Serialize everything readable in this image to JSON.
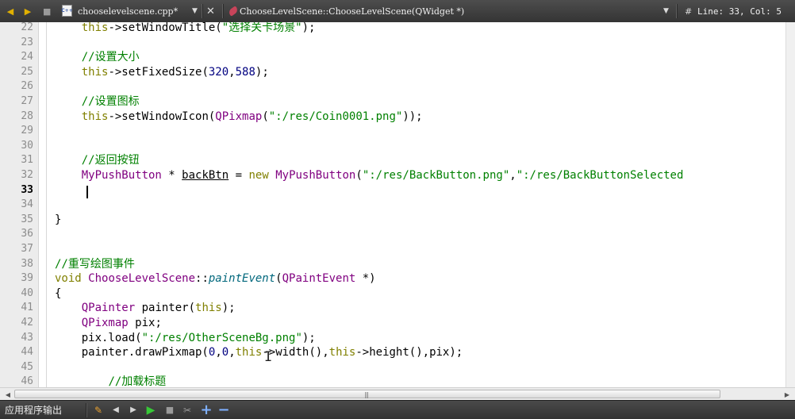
{
  "toolbar": {
    "back_icon": "back-arrow-icon",
    "forward_icon": "forward-arrow-icon",
    "file_badge": "C++",
    "file_name": "chooselevelscene.cpp*",
    "dropdown_arrow": "▼",
    "close_symbol": "✕",
    "function_name": "ChooseLevelScene::ChooseLevelScene(QWidget *)",
    "hash_symbol": "#",
    "line_col": "Line: 33, Col: 5"
  },
  "editor": {
    "current_line": 33,
    "lines": [
      {
        "n": "22",
        "code": "    this->setWindowTitle(\"选择关卡场景\");"
      },
      {
        "n": "23",
        "code": ""
      },
      {
        "n": "24",
        "code": "    //设置大小"
      },
      {
        "n": "25",
        "code": "    this->setFixedSize(320,588);"
      },
      {
        "n": "26",
        "code": ""
      },
      {
        "n": "27",
        "code": "    //设置图标"
      },
      {
        "n": "28",
        "code": "    this->setWindowIcon(QPixmap(\":/res/Coin0001.png\"));"
      },
      {
        "n": "29",
        "code": ""
      },
      {
        "n": "30",
        "code": ""
      },
      {
        "n": "31",
        "code": "    //返回按钮"
      },
      {
        "n": "32",
        "code": "    MyPushButton * backBtn = new MyPushButton(\":/res/BackButton.png\",\":/res/BackButtonSelected"
      },
      {
        "n": "33",
        "code": ""
      },
      {
        "n": "34",
        "code": ""
      },
      {
        "n": "35",
        "code": "}"
      },
      {
        "n": "36",
        "code": ""
      },
      {
        "n": "37",
        "code": ""
      },
      {
        "n": "38",
        "code": "//重写绘图事件"
      },
      {
        "n": "39",
        "code": "void ChooseLevelScene::paintEvent(QPaintEvent *)"
      },
      {
        "n": "40",
        "code": "{"
      },
      {
        "n": "41",
        "code": "    QPainter painter(this);"
      },
      {
        "n": "42",
        "code": "    QPixmap pix;"
      },
      {
        "n": "43",
        "code": "    pix.load(\":/res/OtherSceneBg.png\");"
      },
      {
        "n": "44",
        "code": "    painter.drawPixmap(0,0,this->width(),this->height(),pix);"
      },
      {
        "n": "45",
        "code": ""
      },
      {
        "n": "46",
        "code": "        //加载标题"
      }
    ]
  },
  "bottom": {
    "panel_title": "应用程序输出",
    "icons": [
      "build-icon",
      "previous-icon",
      "next-icon",
      "run-icon",
      "stop-icon",
      "clean-icon",
      "zoom-in-icon",
      "zoom-out-icon"
    ]
  },
  "colors": {
    "comment": "#008000",
    "keyword": "#808000",
    "type": "#800080",
    "string": "#008000",
    "number": "#000080",
    "toolbar_bg": "#3f3f3f"
  }
}
